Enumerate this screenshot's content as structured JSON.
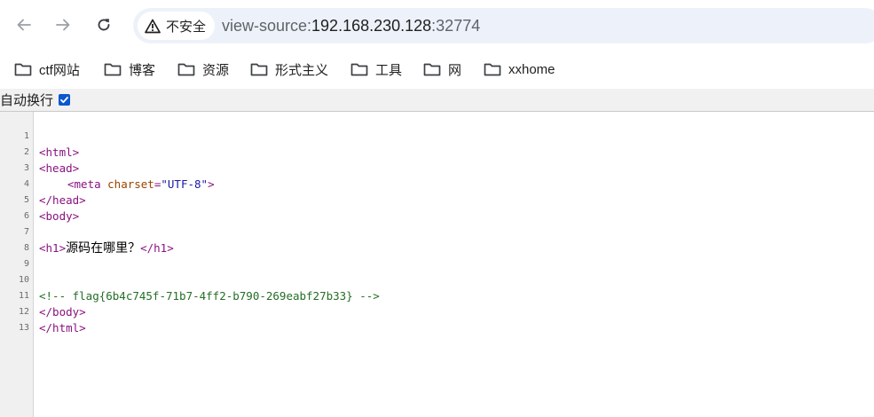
{
  "toolbar": {
    "security_label": "不安全",
    "url_scheme": "view-source:",
    "url_host": "192.168.230.128",
    "url_port": ":32774"
  },
  "bookmarks": [
    {
      "label": "ctf网站",
      "icon": "folder-icon"
    },
    {
      "label": "博客",
      "icon": "folder-icon"
    },
    {
      "label": "资源",
      "icon": "folder-icon"
    },
    {
      "label": "形式主义",
      "icon": "folder-icon"
    },
    {
      "label": "工具",
      "icon": "folder-icon"
    },
    {
      "label": "网",
      "icon": "folder-icon"
    },
    {
      "label": "xxhome",
      "icon": "folder-icon"
    }
  ],
  "view_source": {
    "wrap_label": "自动换行",
    "wrap_checked": true,
    "line_numbers": [
      "1",
      "2",
      "3",
      "4",
      "5",
      "6",
      "7",
      "8",
      "9",
      "10",
      "11",
      "12",
      "13"
    ],
    "lines": {
      "l1_tag": "<html>",
      "l2_tag": "<head>",
      "l3_open": "<meta ",
      "l3_attr": "charset",
      "l3_eq": "=",
      "l3_val": "\"UTF-8\"",
      "l3_close": ">",
      "l4_tag": "</head>",
      "l5_tag": "<body>",
      "l7_open": "<h1>",
      "l7_text": "源码在哪里？",
      "l7_close": "</h1>",
      "l10_comment": "<!-- flag{6b4c745f-71b7-4ff2-b790-269eabf27b33} -->",
      "l11_tag": "</body>",
      "l12_tag": "</html>"
    }
  },
  "colors": {
    "tag": "#881280",
    "attribute": "#994500",
    "value": "#1a1aa6",
    "comment": "#236e25",
    "omnibox_bg": "#edf2fa",
    "checkbox": "#0b57d0"
  }
}
